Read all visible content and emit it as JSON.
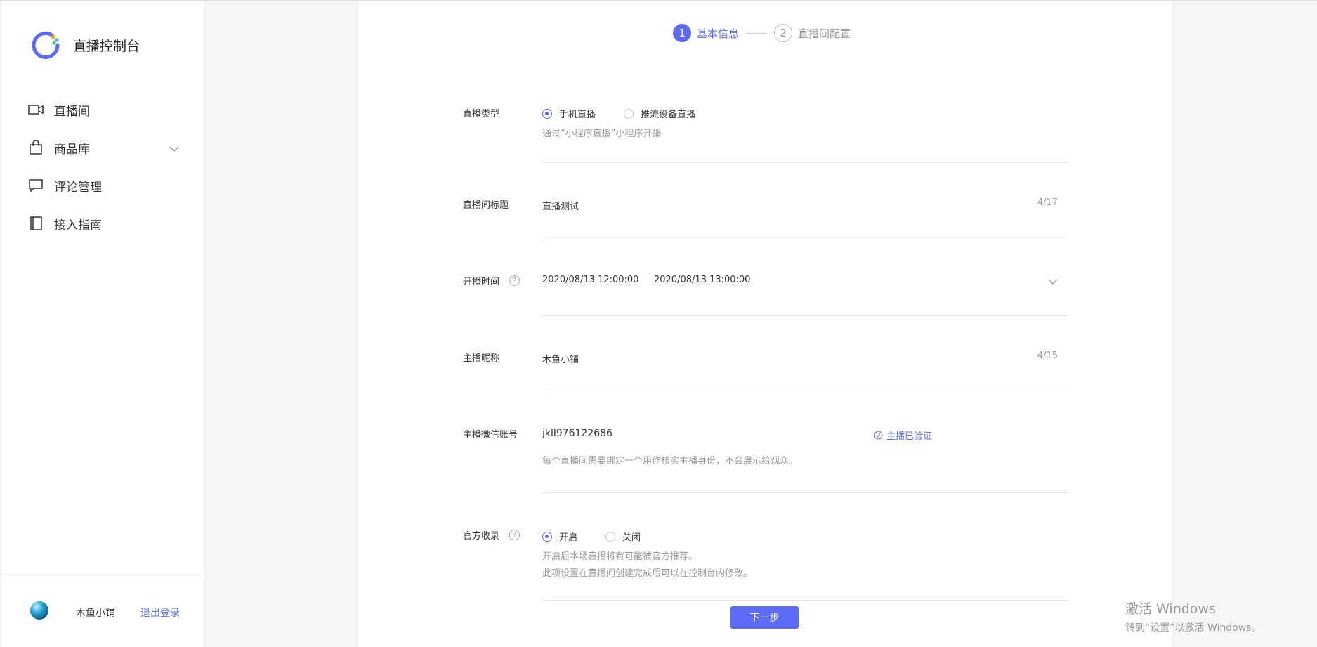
{
  "app": {
    "title": "直播控制台"
  },
  "sidebar": {
    "items": [
      {
        "label": "直播间",
        "icon": "video-camera-icon"
      },
      {
        "label": "商品库",
        "icon": "shopping-bag-icon",
        "has_submenu": true
      },
      {
        "label": "评论管理",
        "icon": "comment-icon"
      },
      {
        "label": "接入指南",
        "icon": "book-icon"
      }
    ],
    "user": {
      "name": "木鱼小铺",
      "logout_label": "退出登录"
    }
  },
  "steps": [
    {
      "number": "1",
      "label": "基本信息",
      "active": true
    },
    {
      "number": "2",
      "label": "直播间配置",
      "active": false
    }
  ],
  "form": {
    "live_type": {
      "label": "直播类型",
      "options": [
        "手机直播",
        "推流设备直播"
      ],
      "selected": "手机直播",
      "hint": "通过“小程序直播”小程序开播"
    },
    "title": {
      "label": "直播间标题",
      "value": "直播测试",
      "counter": "4/17"
    },
    "time": {
      "label": "开播时间",
      "start": "2020/08/13 12:00:00",
      "end": "2020/08/13 13:00:00"
    },
    "anchor_nickname": {
      "label": "主播昵称",
      "value": "木鱼小铺",
      "counter": "4/15"
    },
    "anchor_wechat": {
      "label": "主播微信账号",
      "value": "jkll976122686",
      "verified_label": "主播已验证",
      "hint": "每个直播间需要绑定一个用作核实主播身份，不会展示给观众。"
    },
    "official_collection": {
      "label": "官方收录",
      "options": [
        "开启",
        "关闭"
      ],
      "selected": "开启",
      "hint_line1": "开启后本场直播将有可能被官方推荐。",
      "hint_line2": "此项设置在直播间创建完成后可以在控制台内修改。"
    },
    "next_label": "下一步"
  },
  "watermark": {
    "line1": "激活 Windows",
    "line2": "转到“设置”以激活 Windows。"
  },
  "colors": {
    "accent": "#5b6bf5"
  }
}
